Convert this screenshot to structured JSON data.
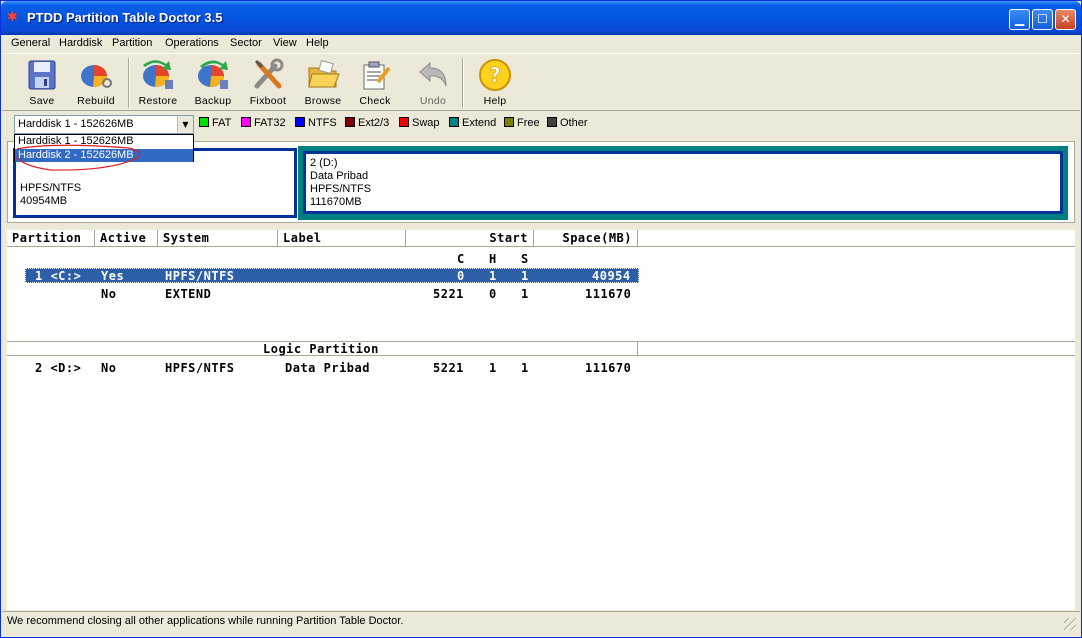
{
  "window": {
    "title": "PTDD Partition Table Doctor 3.5"
  },
  "menu": [
    "General",
    "Harddisk",
    "Partition",
    "Operations",
    "Sector",
    "View",
    "Help"
  ],
  "toolbar": [
    {
      "label": "Save",
      "icon": "floppy-save-icon"
    },
    {
      "label": "Rebuild",
      "icon": "disk-rebuild-icon"
    },
    {
      "label": "Restore",
      "icon": "disk-restore-icon"
    },
    {
      "label": "Backup",
      "icon": "disk-backup-icon"
    },
    {
      "label": "Fixboot",
      "icon": "tools-fixboot-icon"
    },
    {
      "label": "Browse",
      "icon": "folder-browse-icon"
    },
    {
      "label": "Check",
      "icon": "clipboard-check-icon"
    },
    {
      "label": "Undo",
      "icon": "undo-arrow-icon"
    },
    {
      "label": "Help",
      "icon": "help-question-icon"
    }
  ],
  "disk_selector": {
    "selected": "Harddisk 1 - 152626MB",
    "options": [
      "Harddisk 1 - 152626MB",
      "Harddisk 2 - 152626MB"
    ],
    "highlighted_option": "Harddisk 2 - 152626MB"
  },
  "legend": [
    {
      "label": "FAT",
      "color": "#00e000"
    },
    {
      "label": "FAT32",
      "color": "#ff00ff"
    },
    {
      "label": "NTFS",
      "color": "#0000ff"
    },
    {
      "label": "Ext2/3",
      "color": "#800000"
    },
    {
      "label": "Swap",
      "color": "#ff0000"
    },
    {
      "label": "Extend",
      "color": "#008080"
    },
    {
      "label": "Free",
      "color": "#808000"
    },
    {
      "label": "Other",
      "color": "#404040"
    }
  ],
  "partition_map": {
    "c": {
      "fs": "HPFS/NTFS",
      "size": "40954MB"
    },
    "d": {
      "name": "2 (D:)",
      "label": "Data Pribad",
      "fs": "HPFS/NTFS",
      "size": "111670MB"
    }
  },
  "table": {
    "headers": {
      "partition": "Partition",
      "active": "Active",
      "system": "System",
      "label": "Label",
      "start": "Start",
      "space": "Space(MB)"
    },
    "subheaders": {
      "c": "C",
      "h": "H",
      "s": "S"
    },
    "primary_rows": [
      {
        "partition": "1 <C:>",
        "active": "Yes",
        "system": "HPFS/NTFS",
        "label": "",
        "c": "0",
        "h": "1",
        "s": "1",
        "space": "40954"
      },
      {
        "partition": "",
        "active": "No",
        "system": "EXTEND",
        "label": "",
        "c": "5221",
        "h": "0",
        "s": "1",
        "space": "111670"
      }
    ],
    "logic_title": "Logic Partition",
    "logic_rows": [
      {
        "partition": "2 <D:>",
        "active": "No",
        "system": "HPFS/NTFS",
        "label": "Data Pribad",
        "c": "5221",
        "h": "1",
        "s": "1",
        "space": "111670"
      }
    ]
  },
  "status": "We recommend closing all other applications while running Partition Table Doctor."
}
